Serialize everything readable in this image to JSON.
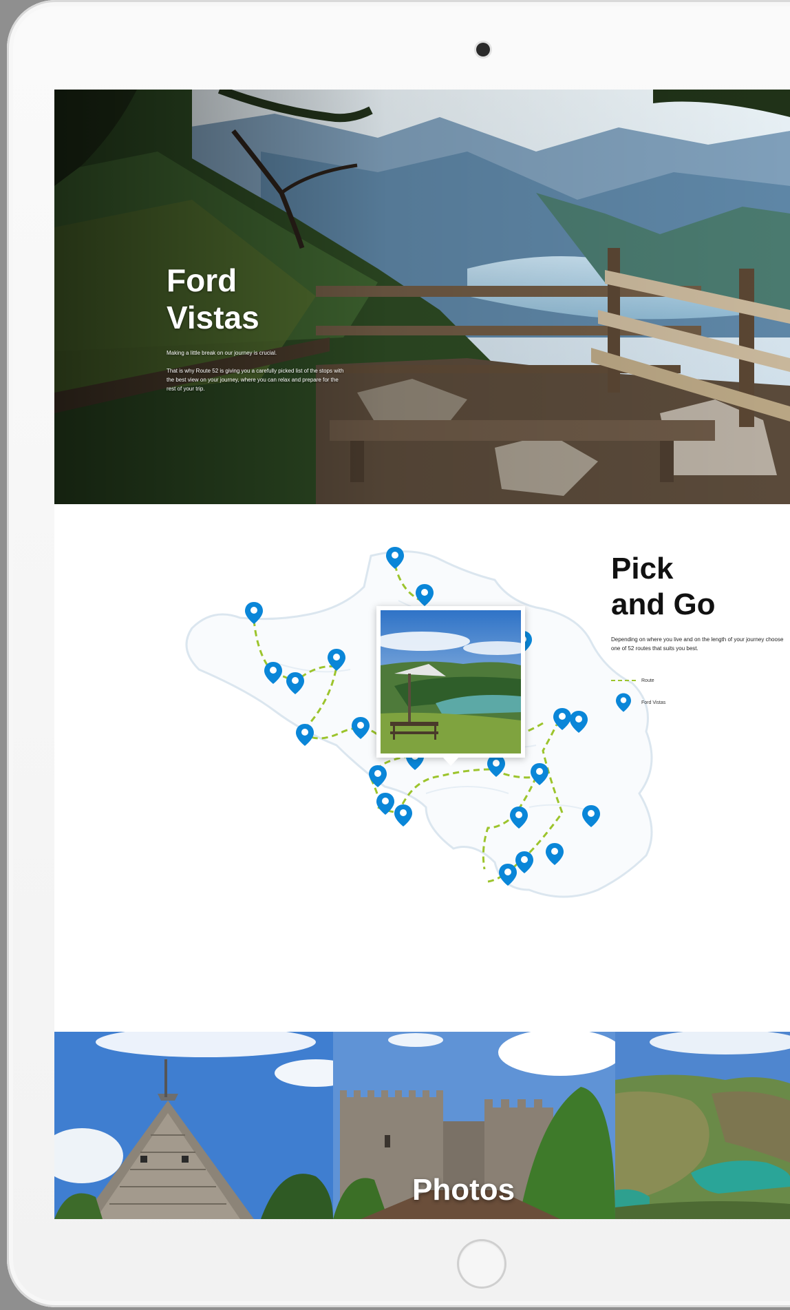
{
  "hero": {
    "title": "Ford\nVistas",
    "paragraph1": "Making a little break on our journey is crucial.",
    "paragraph2": "That is why Route 52 is giving you a carefully picked list of the stops with the best view on your journey, where you can relax and prepare for the rest of your trip."
  },
  "map_section": {
    "title": "Pick\nand Go",
    "description": "Depending on where you live and on the length of your journey choose one of 52 routes that suits you best.",
    "legend": [
      {
        "icon": "dashed-route-line",
        "label": "Route"
      },
      {
        "icon": "map-pin-icon",
        "label": "Ford Vistas"
      }
    ]
  },
  "photos": {
    "label": "Photos"
  },
  "colors": {
    "pin": "#0a86d8",
    "route": "#9cc42c",
    "map_outline": "#dbe6ef"
  }
}
